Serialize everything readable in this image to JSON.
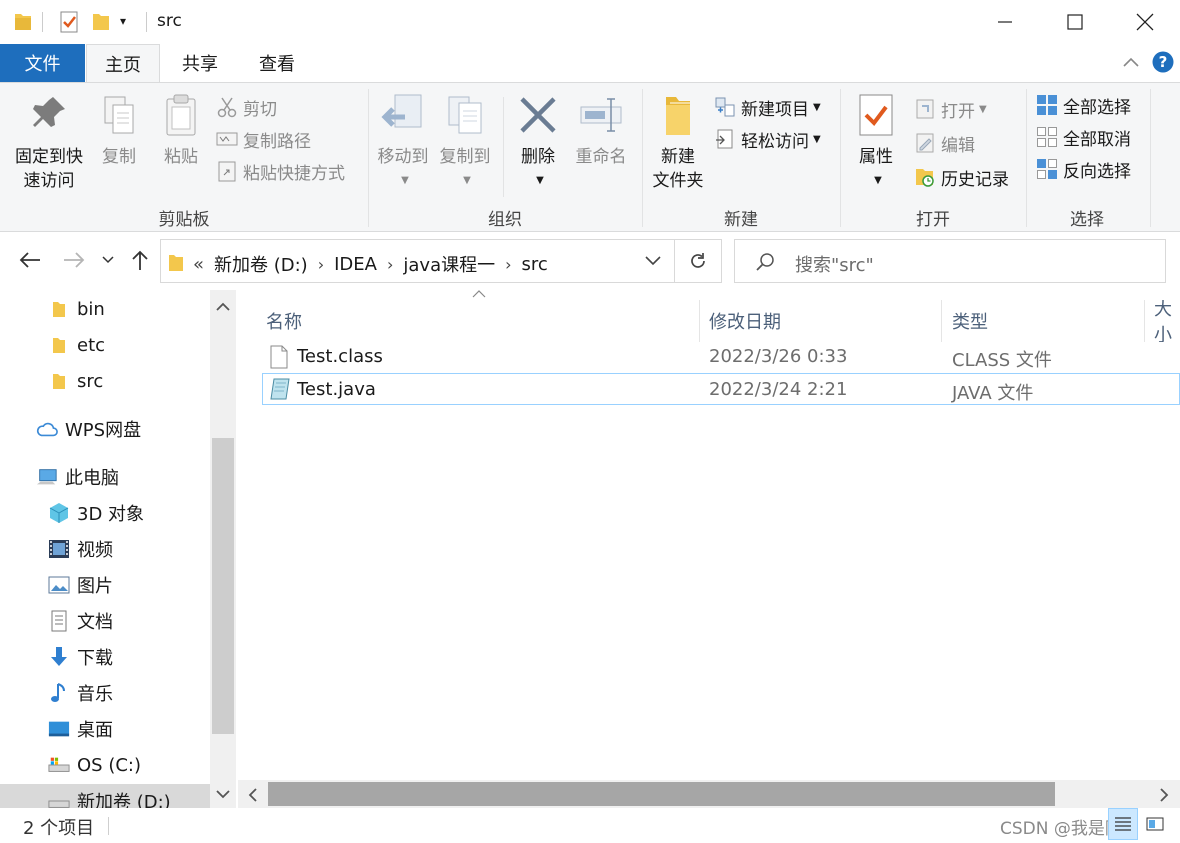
{
  "window": {
    "title": "src"
  },
  "ribbon_tabs": [
    "文件",
    "主页",
    "共享",
    "查看"
  ],
  "ribbon": {
    "clipboard": {
      "pin_label_1": "固定到快",
      "pin_label_2": "速访问",
      "copy": "复制",
      "paste": "粘贴",
      "cut": "剪切",
      "copy_path": "复制路径",
      "paste_shortcut": "粘贴快捷方式",
      "group": "剪贴板"
    },
    "organize": {
      "move_to": "移动到",
      "copy_to": "复制到",
      "delete": "删除",
      "rename": "重命名",
      "group": "组织"
    },
    "new": {
      "new_folder_1": "新建",
      "new_folder_2": "文件夹",
      "new_item": "新建项目",
      "easy_access": "轻松访问",
      "group": "新建"
    },
    "open": {
      "properties": "属性",
      "open": "打开",
      "edit": "编辑",
      "history": "历史记录",
      "group": "打开"
    },
    "select": {
      "select_all": "全部选择",
      "select_none": "全部取消",
      "invert": "反向选择",
      "group": "选择"
    }
  },
  "address": {
    "overflow": "«",
    "crumbs": [
      "新加卷 (D:)",
      "IDEA",
      "java课程一",
      "src"
    ],
    "search_placeholder": "搜索\"src\""
  },
  "nav": {
    "folders": [
      "bin",
      "etc",
      "src"
    ],
    "wps": "WPS网盘",
    "this_pc": "此电脑",
    "pc_items": [
      "3D 对象",
      "视频",
      "图片",
      "文档",
      "下载",
      "音乐",
      "桌面",
      "OS (C:)",
      "新加卷 (D:)"
    ]
  },
  "columns": [
    "名称",
    "修改日期",
    "类型",
    "大小"
  ],
  "files": [
    {
      "name": "Test.class",
      "modified": "2022/3/26 0:33",
      "type": "CLASS 文件"
    },
    {
      "name": "Test.java",
      "modified": "2022/3/24 2:21",
      "type": "JAVA 文件"
    }
  ],
  "status": {
    "item_count": "2 个项目"
  },
  "watermark": "CSDN @我是阿黑",
  "colors": {
    "accent": "#1e6ebd",
    "folder": "#f3c74c",
    "selection_border": "#99d1ff"
  }
}
